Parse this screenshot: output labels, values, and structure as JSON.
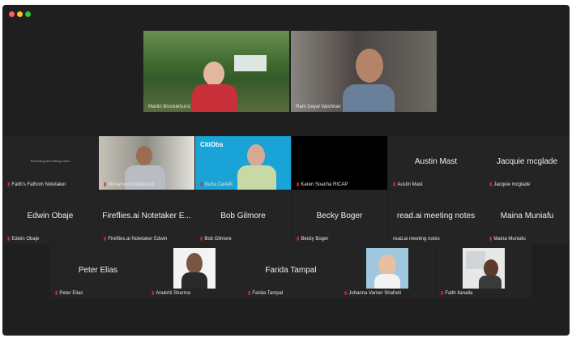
{
  "window_controls": {
    "close_color": "#ff5f57",
    "min_color": "#febc2e",
    "max_color": "#28c840"
  },
  "top_row": [
    {
      "name": "Martin Brocklehurst"
    },
    {
      "name": "Ram Dayal Vaishnav"
    }
  ],
  "middle_row_1": [
    {
      "name": "Faith's Fathom Notetaker",
      "caption": "Recording and taking notes"
    },
    {
      "name": "Mohamed Abdelraouf"
    },
    {
      "name": "Nuria Castell",
      "logo": "CitiObs"
    },
    {
      "name": "Karen Soacha RICAP"
    },
    {
      "name": "Austin Mast",
      "display": "Austin Mast"
    },
    {
      "name": "Jacquie mcglade",
      "display": "Jacquie mcglade"
    }
  ],
  "middle_row_2": [
    {
      "name": "Edwin Obaje",
      "display": "Edwin Obaje"
    },
    {
      "name": "Fireflies.ai Notetaker Edwin",
      "display": "Fireflies.ai Notetaker E..."
    },
    {
      "name": "Bob Gilmore",
      "display": "Bob Gilmore"
    },
    {
      "name": "Becky Boger",
      "display": "Becky Boger"
    },
    {
      "name": "read.ai meeting notes",
      "display": "read.ai meeting notes"
    },
    {
      "name": "Maina Muniafu",
      "display": "Maina Muniafu"
    }
  ],
  "bottom_row": [
    {
      "name": "Peter Elias",
      "display": "Peter Elias"
    },
    {
      "name": "Anukriti Sharma"
    },
    {
      "name": "Farida Tampal",
      "display": "Farida Tampal"
    },
    {
      "name": "Johanna Varner Shafreti"
    },
    {
      "name": "Faith Ilanalla"
    }
  ]
}
